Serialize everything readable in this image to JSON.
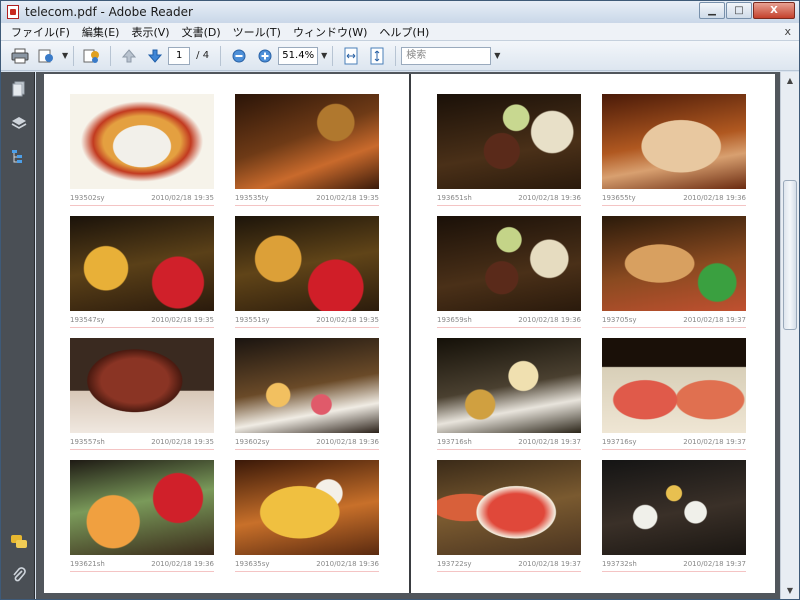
{
  "window": {
    "title": "telecom.pdf - Adobe Reader",
    "controls": {
      "minimize": "▁",
      "maximize": "□",
      "close": "X"
    }
  },
  "menu": [
    "ファイル(F)",
    "編集(E)",
    "表示(V)",
    "文書(D)",
    "ツール(T)",
    "ウィンドウ(W)",
    "ヘルプ(H)"
  ],
  "menu_close": "x",
  "toolbar": {
    "page_current": "1",
    "page_total": "/ 4",
    "zoom": "51.4%",
    "search_placeholder": "検索"
  },
  "pages": {
    "left": [
      {
        "id": "193502sy",
        "date": "2010/02/18 19:35"
      },
      {
        "id": "193535ty",
        "date": "2010/02/18 19:35"
      },
      {
        "id": "193547sy",
        "date": "2010/02/18 19:35"
      },
      {
        "id": "193551sy",
        "date": "2010/02/18 19:35"
      },
      {
        "id": "193557sh",
        "date": "2010/02/18 19:35"
      },
      {
        "id": "193602sy",
        "date": "2010/02/18 19:36"
      },
      {
        "id": "193621sh",
        "date": "2010/02/18 19:36"
      },
      {
        "id": "193635sy",
        "date": "2010/02/18 19:36"
      }
    ],
    "right": [
      {
        "id": "193651sh",
        "date": "2010/02/18 19:36"
      },
      {
        "id": "193655ty",
        "date": "2010/02/18 19:36"
      },
      {
        "id": "193659sh",
        "date": "2010/02/18 19:36"
      },
      {
        "id": "193705sy",
        "date": "2010/02/18 19:37"
      },
      {
        "id": "193716sh",
        "date": "2010/02/18 19:37"
      },
      {
        "id": "193716sy",
        "date": "2010/02/18 19:37"
      },
      {
        "id": "193722sy",
        "date": "2010/02/18 19:37"
      },
      {
        "id": "193732sh",
        "date": "2010/02/18 19:37"
      }
    ]
  },
  "colors": {
    "accent": "#2f6fb5",
    "caption_line": "#f4c4c4",
    "doc_background": "#51565c"
  }
}
